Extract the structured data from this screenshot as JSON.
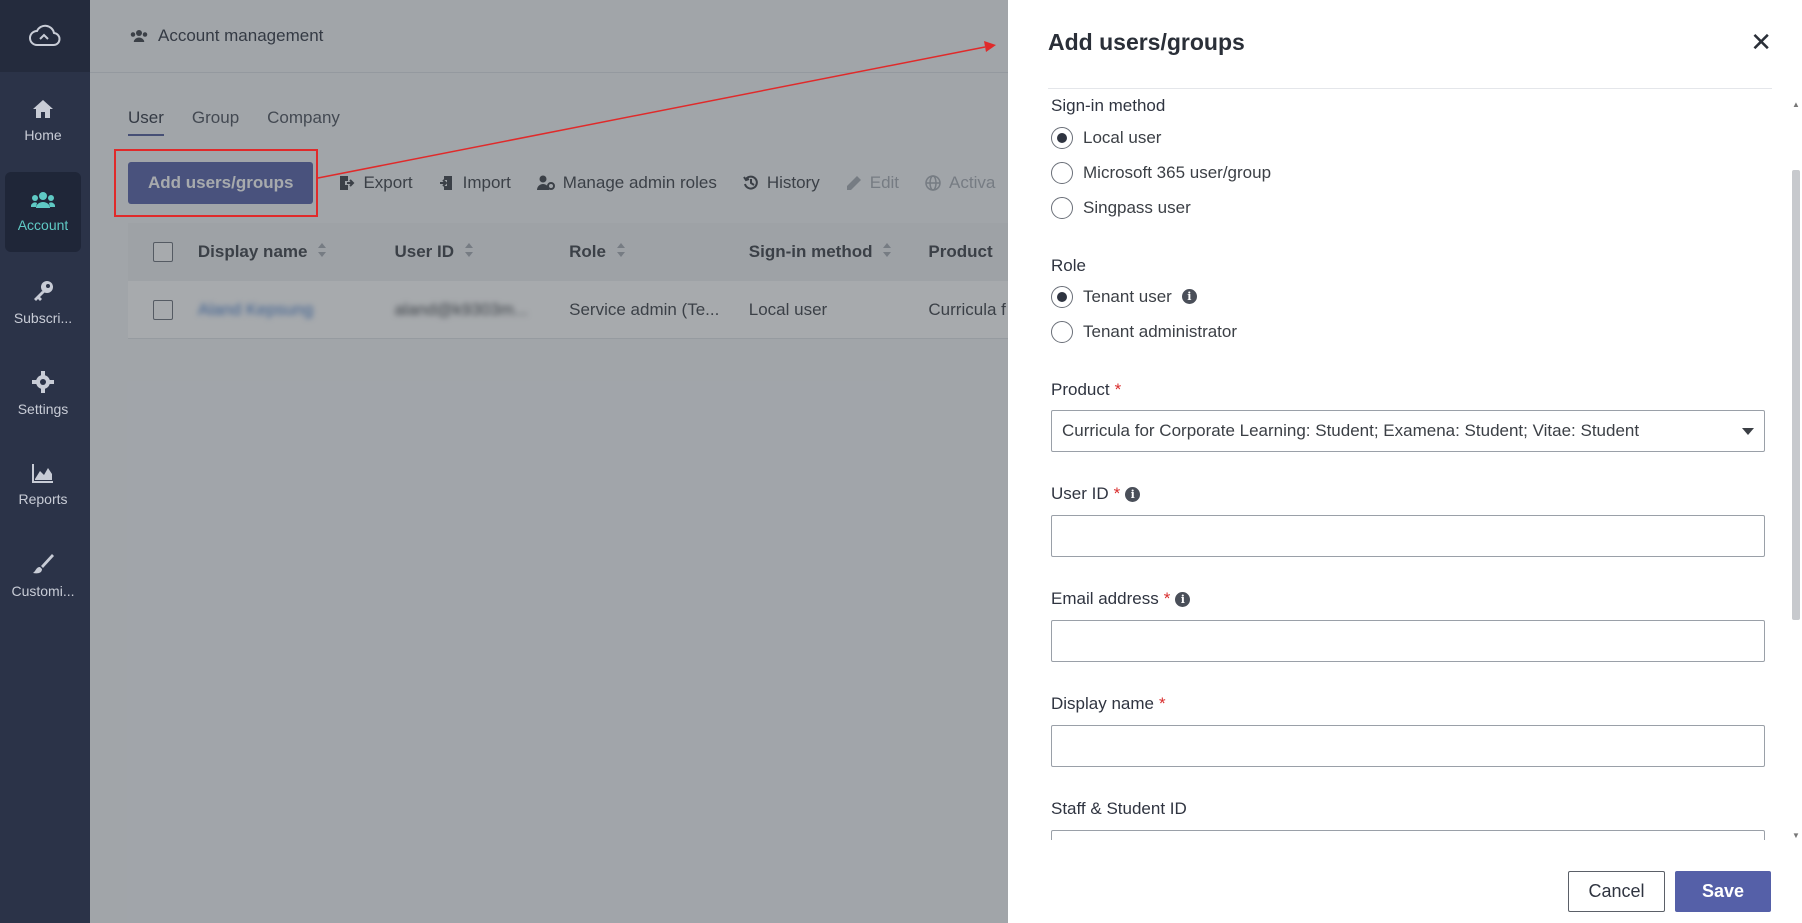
{
  "sidebar": {
    "logo_icon": "cloud-icon",
    "items": [
      {
        "label": "Home",
        "icon": "home-icon"
      },
      {
        "label": "Account",
        "icon": "users-icon",
        "active": true
      },
      {
        "label": "Subscri...",
        "icon": "key-icon"
      },
      {
        "label": "Settings",
        "icon": "gear-icon"
      },
      {
        "label": "Reports",
        "icon": "chart-icon"
      },
      {
        "label": "Customi...",
        "icon": "brush-icon"
      }
    ]
  },
  "header": {
    "title": "Account management"
  },
  "tabs": [
    "User",
    "Group",
    "Company"
  ],
  "toolbar": {
    "add_label": "Add users/groups",
    "export_label": "Export",
    "import_label": "Import",
    "manage_label": "Manage admin roles",
    "history_label": "History",
    "edit_label": "Edit",
    "activate_label": "Activa"
  },
  "table": {
    "columns": [
      "Display name",
      "User ID",
      "Role",
      "Sign-in method",
      "Product"
    ],
    "rows": [
      {
        "display_name": "Aland Kepsung",
        "user_id": "aland@k9303m...",
        "role": "Service admin (Te...",
        "signin": "Local user",
        "product": "Curricula f"
      }
    ]
  },
  "panel": {
    "title": "Add users/groups",
    "signin_label": "Sign-in method",
    "signin_options": [
      "Local user",
      "Microsoft 365 user/group",
      "Singpass user"
    ],
    "signin_selected": 0,
    "role_label": "Role",
    "role_options": [
      "Tenant user",
      "Tenant administrator"
    ],
    "role_selected": 0,
    "product_label": "Product",
    "product_value": "Curricula for Corporate Learning: Student; Examena: Student; Vitae: Student",
    "userid_label": "User ID",
    "email_label": "Email address",
    "displayname_label": "Display name",
    "staff_label": "Staff & Student ID",
    "required_mark": "*",
    "cancel_label": "Cancel",
    "save_label": "Save"
  },
  "colors": {
    "accent": "#5560a8",
    "sidebar": "#2b3348",
    "active_nav": "#5fc9c4",
    "annotation": "#e02a2a"
  }
}
